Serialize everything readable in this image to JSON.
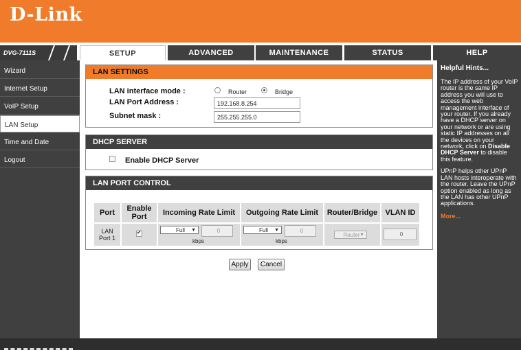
{
  "brand": {
    "logo": "D-Link",
    "model": "DVG-7111S"
  },
  "tabs": [
    "SETUP",
    "ADVANCED",
    "MAINTENANCE",
    "STATUS",
    "HELP"
  ],
  "sidebar": {
    "items": [
      "Wizard",
      "Internet Setup",
      "VoIP Setup",
      "LAN Setup",
      "Time and Date",
      "Logout"
    ]
  },
  "lan_settings": {
    "title": "LAN SETTINGS",
    "mode_label": "LAN interface mode :",
    "mode_options": [
      "Router",
      "Bridge"
    ],
    "address_label": "LAN Port Address :",
    "address_value": "192.168.8.254",
    "mask_label": "Subnet mask :",
    "mask_value": "255.255.255.0"
  },
  "dhcp": {
    "title": "DHCP SERVER",
    "enable_label": "Enable DHCP Server"
  },
  "lan_port_control": {
    "title": "LAN PORT CONTROL",
    "headers": [
      "Port",
      "Enable Port",
      "Incoming Rate Limit",
      "Outgoing Rate Limit",
      "Router/Bridge",
      "VLAN ID"
    ],
    "row": {
      "port": "LAN Port 1",
      "incoming_mode": "Full",
      "incoming_value": "0",
      "outgoing_mode": "Full",
      "outgoing_value": "0",
      "unit": "kbps",
      "router_bridge": "Router",
      "vlan_id": "0"
    }
  },
  "buttons": {
    "apply": "Apply",
    "cancel": "Cancel"
  },
  "hints": {
    "title": "Helpful Hints...",
    "p1_pre": "The IP address of your VoIP router is the same IP address you will use to access the web management interface of your router. If you already have a DHCP server on your network or are using static IP addresses on all the devices on your network, click on ",
    "p1_bold": "Disable DHCP Server",
    "p1_post": " to disable this feature.",
    "p2": "UPnP helps other UPnP LAN hosts interoperate with the router. Leave the UPnP option enabled as long as the LAN has other UPnP applications.",
    "more": "More..."
  }
}
